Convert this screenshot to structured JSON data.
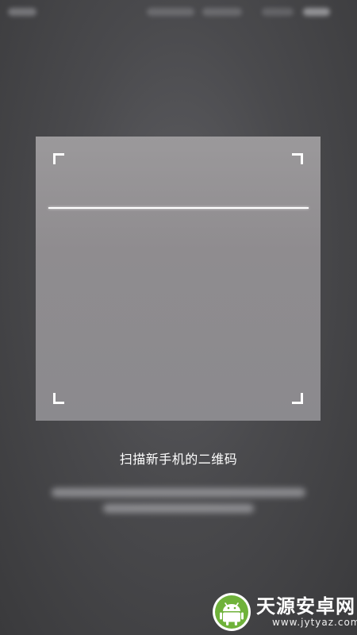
{
  "scanner": {
    "prompt": "扫描新手机的二维码"
  },
  "watermark": {
    "brand": "天源安卓网",
    "url": "www.jytyaz.com",
    "accent": "#6fb23a",
    "icon": "android-robot-icon"
  },
  "colors": {
    "scan_line": "#ffffff",
    "frame_corners": "#ffffff"
  }
}
